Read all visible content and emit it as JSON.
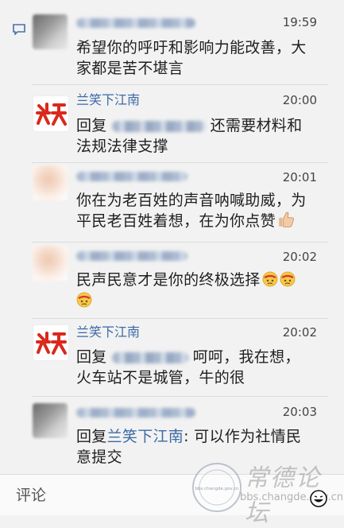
{
  "comments": [
    {
      "name": "",
      "time": "19:59",
      "lines": [
        "希望你的呼吁和影响力能改善，大",
        "家都是苦不堪言"
      ]
    },
    {
      "name": "兰笑下江南",
      "time": "20:00",
      "reply_prefix": "回复",
      "reply_rest": "还需要材料和",
      "line2": "法规法律支撑"
    },
    {
      "name": "",
      "time": "20:01",
      "lines": [
        "你在为老百姓的声音呐喊助威，为",
        "平民老百姓着想，在为你点赞"
      ]
    },
    {
      "name": "",
      "time": "20:02",
      "lines": [
        "民声民意才是你的终极选择"
      ]
    },
    {
      "name": "兰笑下江南",
      "time": "20:02",
      "reply_prefix": "回复",
      "reply_rest": "呵呵，我在想，",
      "line2": "火车站不是城管，牛的很"
    },
    {
      "name": "",
      "time": "20:03",
      "reply_prefix": "回复",
      "reply_target": "兰笑下江南",
      "reply_rest": ": 可以作为社情民",
      "line2": "意提交"
    }
  ],
  "input": {
    "placeholder": "评论"
  },
  "watermark": {
    "title": "常德论坛",
    "url": "bbs.changde.gov.cn",
    "badge_text": "bbs.changde.gov.cn"
  },
  "icons": {
    "side": "chat-bubble-icon",
    "brand_logo": "lanxiao-logo",
    "emoji": [
      "thumbs-up-icon",
      "dizzy-face-emoji",
      "smile-face-icon"
    ]
  },
  "colors": {
    "brand": "#3c6aa6",
    "background": "#f2f2f2"
  }
}
